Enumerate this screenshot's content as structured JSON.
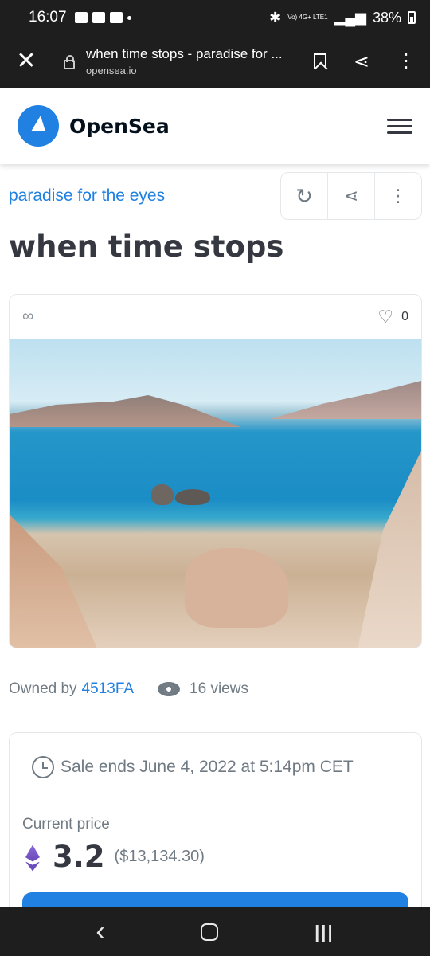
{
  "status": {
    "time": "16:07",
    "network": "Vo) 4G+ LTE1",
    "battery": "38%"
  },
  "browser": {
    "page_title": "when time stops - paradise for ...",
    "domain": "opensea.io"
  },
  "header": {
    "brand": "OpenSea"
  },
  "item": {
    "collection": "paradise for the eyes",
    "title": "when time stops",
    "favorites": "0",
    "owned_by_label": "Owned by",
    "owner": "4513FA",
    "views": "16 views"
  },
  "listing": {
    "sale_ends": "Sale ends June 4, 2022 at 5:14pm CET",
    "price_label": "Current price",
    "price": "3.2",
    "price_usd": "($13,134.30)"
  },
  "colors": {
    "accent": "#2081e2",
    "text": "#353840",
    "muted": "#707a83"
  }
}
